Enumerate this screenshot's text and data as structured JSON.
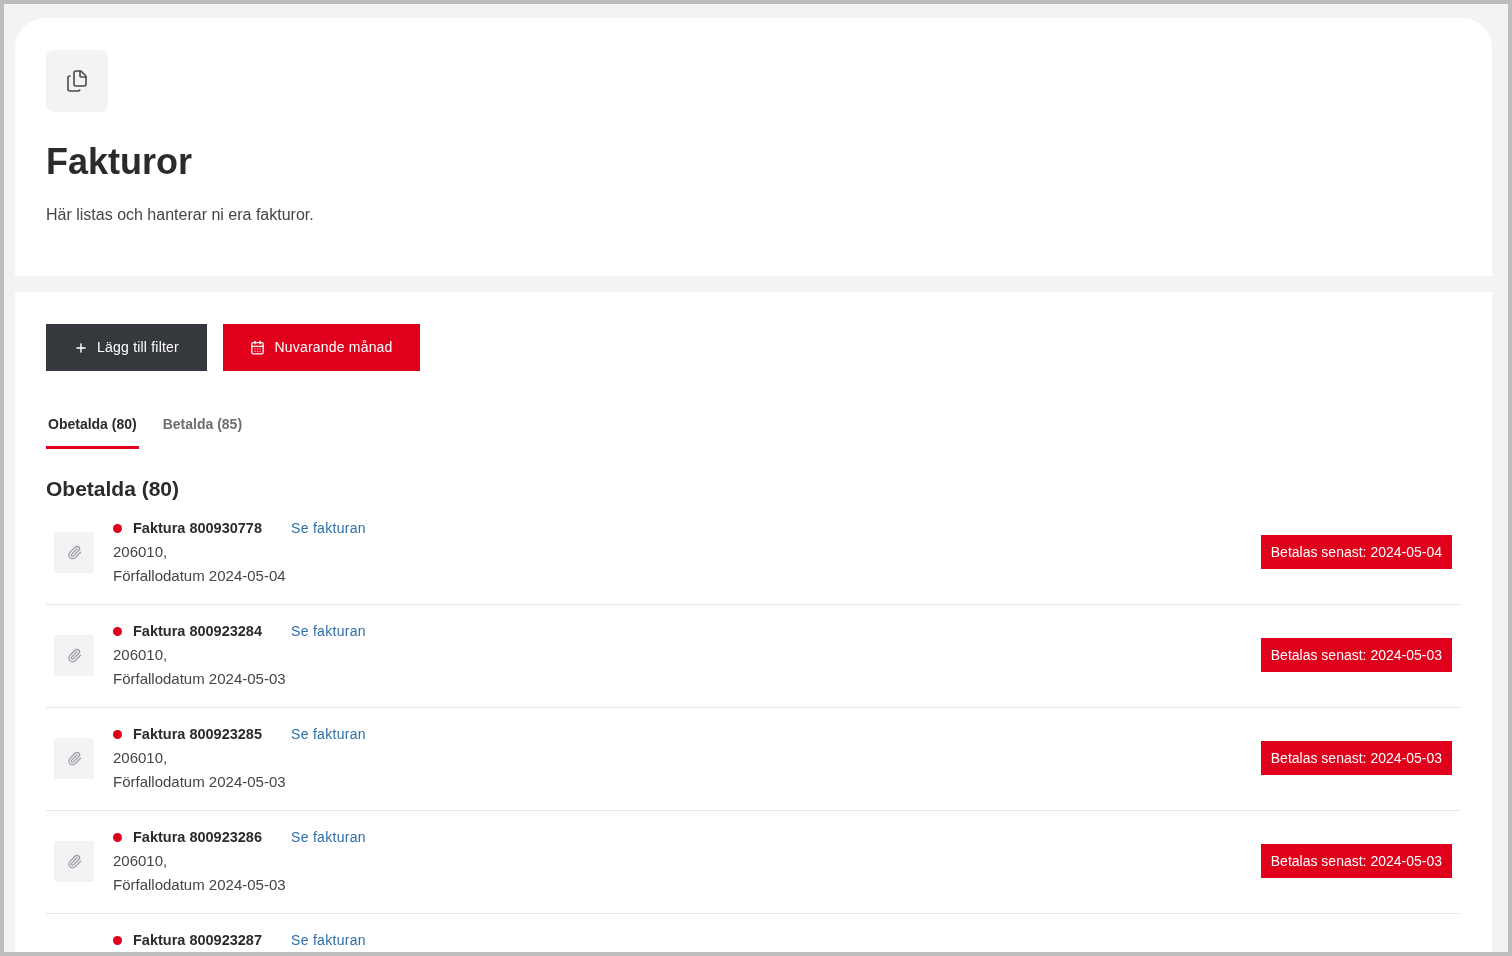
{
  "header": {
    "title": "Fakturor",
    "description": "Här listas och hanterar ni era fakturor."
  },
  "toolbar": {
    "buttons": [
      {
        "kind": "add",
        "label": "Lägg till filter"
      },
      {
        "kind": "date",
        "label": "Nuvarande månad"
      }
    ]
  },
  "tabs": [
    {
      "label": "Obetalda (80)",
      "selected": true
    },
    {
      "label": "Betalda (85)",
      "selected": false
    }
  ],
  "section_title": "Obetalda (80)",
  "invoices": [
    {
      "title": "Faktura 800930778",
      "link": "Se fakturan",
      "account": "206010,",
      "due": "Förfallodatum 2024-05-04",
      "badge": "Betalas senast: 2024-05-04"
    },
    {
      "title": "Faktura 800923284",
      "link": "Se fakturan",
      "account": "206010,",
      "due": "Förfallodatum 2024-05-03",
      "badge": "Betalas senast: 2024-05-03"
    },
    {
      "title": "Faktura 800923285",
      "link": "Se fakturan",
      "account": "206010,",
      "due": "Förfallodatum 2024-05-03",
      "badge": "Betalas senast: 2024-05-03"
    },
    {
      "title": "Faktura 800923286",
      "link": "Se fakturan",
      "account": "206010,",
      "due": "Förfallodatum 2024-05-03",
      "badge": "Betalas senast: 2024-05-03"
    },
    {
      "title": "Faktura 800923287",
      "link": "Se fakturan"
    }
  ]
}
